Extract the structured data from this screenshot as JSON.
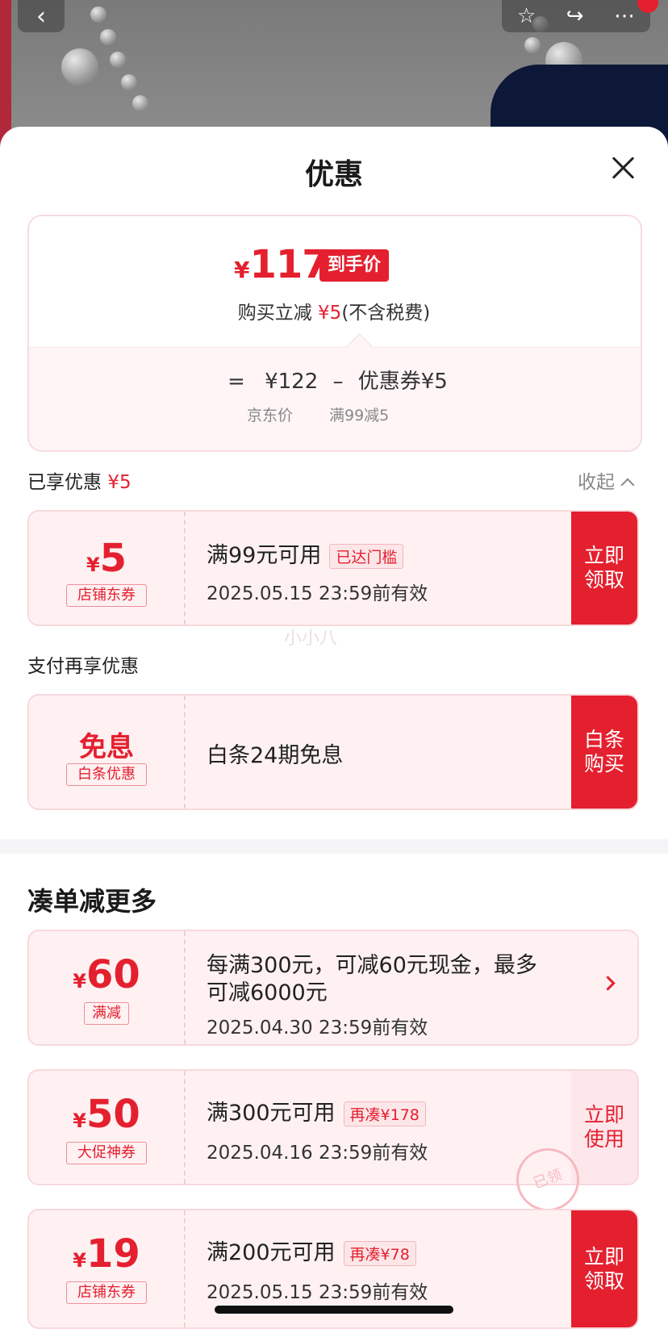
{
  "sheet": {
    "title": "优惠"
  },
  "price_card": {
    "currency": "¥",
    "final_price": "117",
    "tag": "到手价",
    "sub_prefix": "购买立减",
    "sub_amount": "¥5",
    "sub_suffix": "(不含税费)",
    "formula_eq": "=",
    "jd_price": "¥122",
    "minus": "–",
    "coupon_text": "优惠券¥5",
    "jd_price_caption": "京东价",
    "coupon_caption": "满99减5"
  },
  "enjoyed": {
    "label": "已享优惠",
    "amount": "¥5",
    "collapse": "收起"
  },
  "coupons_enjoyed": [
    {
      "yen": "¥",
      "amount": "5",
      "type": "店铺东券",
      "desc": "满99元可用",
      "pill": "已达门槛",
      "date": "2025.05.15 23:59前有效",
      "button": "立即\n领取"
    }
  ],
  "pay_section": {
    "label": "支付再享优惠"
  },
  "baitiao": {
    "title": "免息",
    "type": "白条优惠",
    "desc": "白条24期免息",
    "button": "白条\n购买"
  },
  "more_section": {
    "title": "凑单减更多"
  },
  "coupons_more": [
    {
      "yen": "¥",
      "amount": "60",
      "type": "满减",
      "desc_line1": "每满300元，可减60元现金，最多",
      "desc_line2": "可减6000元",
      "date": "2025.04.30 23:59前有效"
    },
    {
      "yen": "¥",
      "amount": "50",
      "type": "大促神券",
      "desc": "满300元可用",
      "pill": "再凑¥178",
      "date": "2025.04.16 23:59前有效",
      "button": "立即\n使用",
      "stamp": "已领"
    },
    {
      "yen": "¥",
      "amount": "19",
      "type": "店铺东券",
      "desc": "满200元可用",
      "pill": "再凑¥78",
      "date": "2025.05.15 23:59前有效",
      "button": "立即\n领取"
    }
  ],
  "watermark": "小小八",
  "colors": {
    "accent": "#e4202f",
    "coupon_bg": "#fff1f2"
  },
  "icons": [
    "back-icon",
    "star-icon",
    "share-icon",
    "more-icon",
    "close-icon",
    "chevron-up-icon",
    "chevron-right-icon"
  ]
}
